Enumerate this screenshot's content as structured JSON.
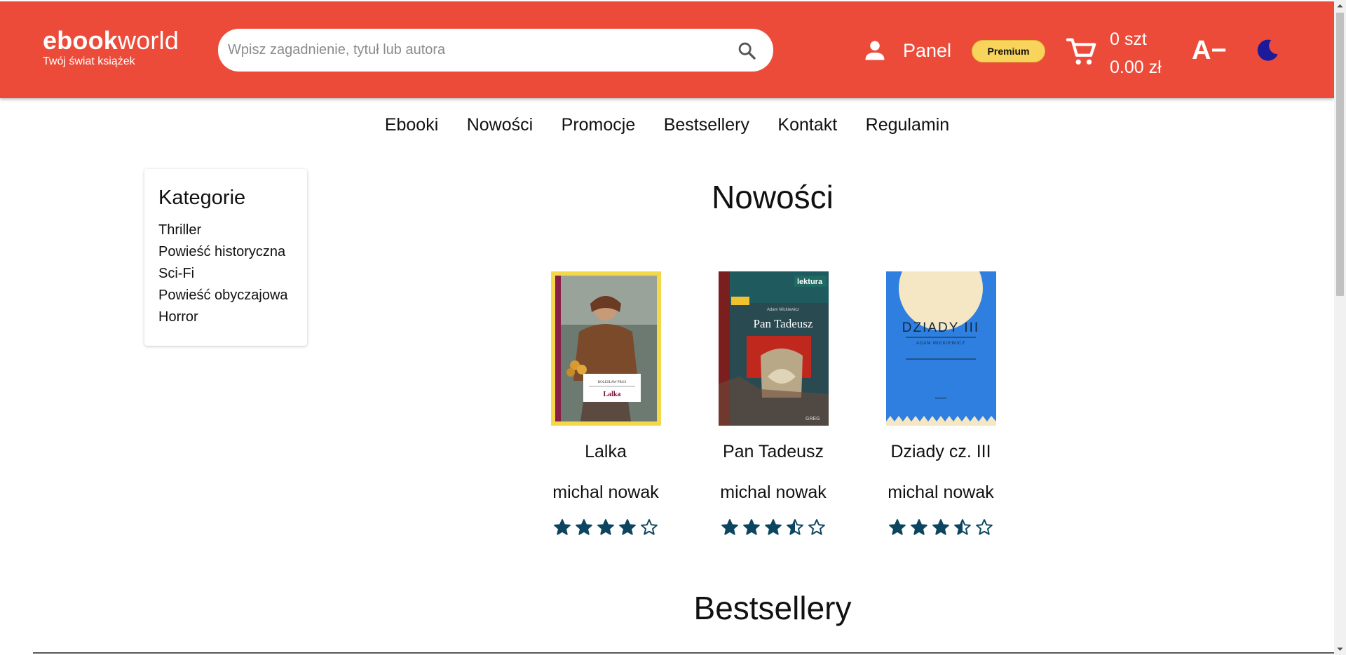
{
  "brand": {
    "name_bold": "ebook",
    "name_light": "world",
    "tagline": "Twój świat książek"
  },
  "search": {
    "placeholder": "Wpisz zagadnienie, tytuł lub autora"
  },
  "header": {
    "panel_label": "Panel",
    "premium_label": "Premium",
    "cart_count": "0 szt",
    "cart_total": "0.00 zł",
    "font_toggle": "A−"
  },
  "nav": [
    "Ebooki",
    "Nowości",
    "Promocje",
    "Bestsellery",
    "Kontakt",
    "Regulamin"
  ],
  "sidebar": {
    "title": "Kategorie",
    "items": [
      "Thriller",
      "Powieść historyczna",
      "Sci-Fi",
      "Powieść obyczajowa",
      "Horror"
    ]
  },
  "sections": {
    "new": "Nowości",
    "bestsellers": "Bestsellery"
  },
  "books": [
    {
      "title": "Lalka",
      "author": "michal nowak",
      "rating": 4,
      "cover": {
        "author_line": "BOLESŁAW PRUS",
        "title_line": "Lalka"
      }
    },
    {
      "title": "Pan Tadeusz",
      "author": "michal nowak",
      "rating": 3.5,
      "cover": {
        "badge": "lektura",
        "author_line": "Adam Mickiewicz",
        "title_line": "Pan Tadeusz",
        "publisher": "GREG"
      }
    },
    {
      "title": "Dziady cz. III",
      "author": "michal nowak",
      "rating": 3.5,
      "cover": {
        "title_line": "DZIADY III",
        "author_line": "ADAM MICKIEWICZ",
        "publisher": "GRAMAT"
      }
    }
  ],
  "colors": {
    "header": "#ec4b3a",
    "premium": "#f8d45c",
    "star": "#0d4560",
    "moon": "#1a1a9a"
  },
  "icons": [
    "search-icon",
    "person-icon",
    "cart-icon",
    "moon-icon",
    "star-icon"
  ]
}
